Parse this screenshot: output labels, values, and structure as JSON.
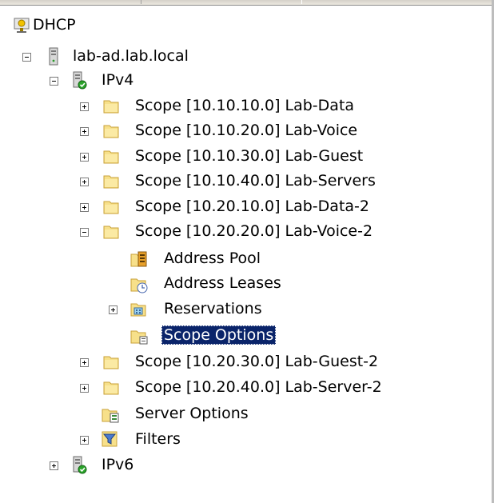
{
  "tree": {
    "root": {
      "label": "DHCP",
      "icon": "dhcp-icon"
    },
    "server": {
      "label": "lab-ad.lab.local",
      "icon": "server-icon",
      "expanded": true
    },
    "ipv4": {
      "label": "IPv4",
      "icon": "ipv4-icon",
      "expanded": true
    },
    "scopes": [
      {
        "label": "Scope [10.10.10.0] Lab-Data",
        "expanded": false
      },
      {
        "label": "Scope [10.10.20.0] Lab-Voice",
        "expanded": false
      },
      {
        "label": "Scope [10.10.30.0] Lab-Guest",
        "expanded": false
      },
      {
        "label": "Scope [10.10.40.0] Lab-Servers",
        "expanded": false
      },
      {
        "label": "Scope [10.20.10.0] Lab-Data-2",
        "expanded": false
      },
      {
        "label": "Scope [10.20.20.0] Lab-Voice-2",
        "expanded": true
      },
      {
        "label": "Scope [10.20.30.0] Lab-Guest-2",
        "expanded": false
      },
      {
        "label": "Scope [10.20.40.0] Lab-Server-2",
        "expanded": false
      }
    ],
    "scope_children": [
      {
        "label": "Address Pool",
        "icon": "address-pool-icon"
      },
      {
        "label": "Address Leases",
        "icon": "address-leases-icon"
      },
      {
        "label": "Reservations",
        "icon": "reservations-icon",
        "expandable": true
      },
      {
        "label": "Scope Options",
        "icon": "scope-options-icon",
        "selected": true
      }
    ],
    "server_options": {
      "label": "Server Options",
      "icon": "server-options-icon"
    },
    "filters": {
      "label": "Filters",
      "icon": "filter-icon"
    },
    "ipv6": {
      "label": "IPv6",
      "icon": "ipv6-icon",
      "expanded": false
    }
  },
  "colors": {
    "selection_bg": "#0a246a",
    "selection_fg": "#ffffff",
    "folder_fill": "#f7e08a",
    "folder_edge": "#c9a23a"
  }
}
